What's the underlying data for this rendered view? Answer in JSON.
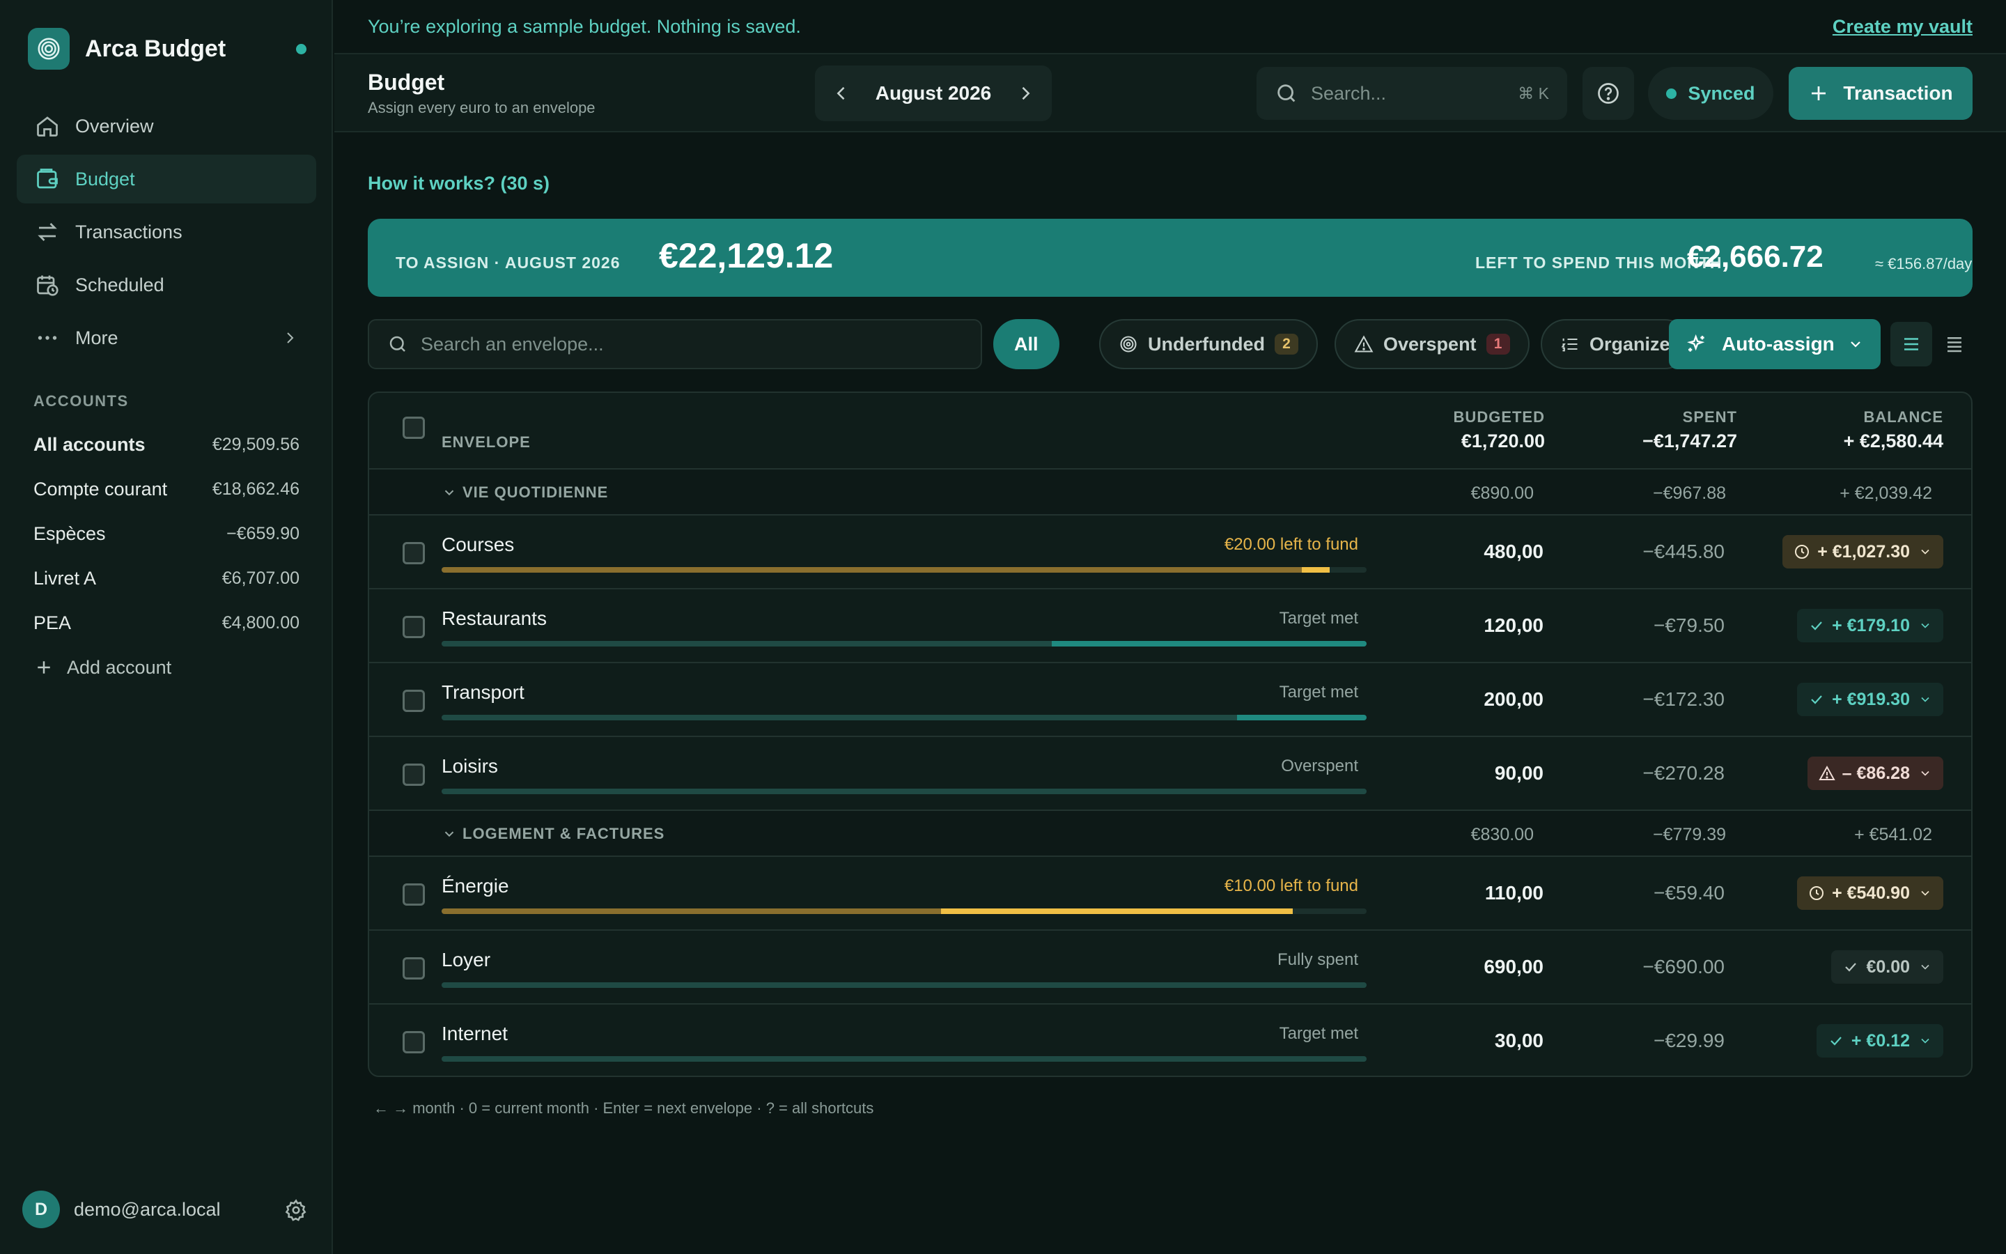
{
  "sidebar": {
    "brand": "Arca Budget",
    "nav": [
      {
        "label": "Overview",
        "icon": "home-icon"
      },
      {
        "label": "Budget",
        "icon": "wallet-icon"
      },
      {
        "label": "Transactions",
        "icon": "transfer-arrows-icon"
      },
      {
        "label": "Scheduled",
        "icon": "calendar-clock-icon"
      },
      {
        "label": "More",
        "icon": "more-dots-icon"
      }
    ],
    "accounts_heading": "ACCOUNTS",
    "accounts": [
      {
        "name": "All accounts",
        "amount": "€29,509.56"
      },
      {
        "name": "Compte courant",
        "amount": "€18,662.46"
      },
      {
        "name": "Espèces",
        "amount": "−€659.90"
      },
      {
        "name": "Livret A",
        "amount": "€6,707.00"
      },
      {
        "name": "PEA",
        "amount": "€4,800.00"
      }
    ],
    "add_account": "Add account",
    "user": {
      "initial": "D",
      "email": "demo@arca.local"
    }
  },
  "banner": {
    "message": "You’re exploring a sample budget. Nothing is saved.",
    "action": "Create my vault"
  },
  "header": {
    "title": "Budget",
    "subtitle": "Assign every euro to an envelope",
    "month": "August 2026",
    "search_placeholder": "Search...",
    "search_shortcut": "⌘ K",
    "sync_status": "Synced",
    "transaction_button": "Transaction"
  },
  "how_it_works": "How it works? (30 s)",
  "summary": {
    "to_assign_label": "TO ASSIGN · AUGUST 2026",
    "to_assign_value": "€22,129.12",
    "left_label": "LEFT TO SPEND THIS MONTH",
    "left_value": "€2,666.72",
    "per_day": "≈ €156.87/day"
  },
  "filters": {
    "search_placeholder": "Search an envelope...",
    "all": "All",
    "underfunded": "Underfunded",
    "underfunded_count": "2",
    "overspent": "Overspent",
    "overspent_count": "1",
    "organize": "Organize",
    "auto_assign": "Auto-assign"
  },
  "table": {
    "headers": {
      "envelope": "ENVELOPE",
      "budgeted": "BUDGETED",
      "budgeted_total": "€1,720.00",
      "spent": "SPENT",
      "spent_total": "−€1,747.27",
      "balance": "BALANCE",
      "balance_total": "+ €2,580.44"
    },
    "groups": [
      {
        "name": "VIE QUOTIDIENNE",
        "budgeted": "€890.00",
        "spent": "−€967.88",
        "balance": "+ €2,039.42",
        "rows": [
          {
            "name": "Courses",
            "status": "€20.00 left to fund",
            "budgeted": "480,00",
            "spent": "−€445.80",
            "balance": "+ €1,027.30",
            "balance_state": "underfunded",
            "progress_spent": 0.93,
            "progress_budget": 0.96
          },
          {
            "name": "Restaurants",
            "status": "Target met",
            "budgeted": "120,00",
            "spent": "−€79.50",
            "balance": "+ €179.10",
            "balance_state": "ok",
            "progress_spent": 0.66,
            "progress_budget": 1.0
          },
          {
            "name": "Transport",
            "status": "Target met",
            "budgeted": "200,00",
            "spent": "−€172.30",
            "balance": "+ €919.30",
            "balance_state": "ok",
            "progress_spent": 0.86,
            "progress_budget": 1.0
          },
          {
            "name": "Loisirs",
            "status": "Overspent",
            "budgeted": "90,00",
            "spent": "−€270.28",
            "balance": "– €86.28",
            "balance_state": "overspent",
            "progress_spent": 1.0,
            "progress_budget": 1.0
          }
        ]
      },
      {
        "name": "LOGEMENT & FACTURES",
        "budgeted": "€830.00",
        "spent": "−€779.39",
        "balance": "+ €541.02",
        "rows": [
          {
            "name": "Énergie",
            "status": "€10.00 left to fund",
            "budgeted": "110,00",
            "spent": "−€59.40",
            "balance": "+ €540.90",
            "balance_state": "underfunded",
            "progress_spent": 0.54,
            "progress_budget": 0.92
          },
          {
            "name": "Loyer",
            "status": "Fully spent",
            "budgeted": "690,00",
            "spent": "−€690.00",
            "balance": "€0.00",
            "balance_state": "zero",
            "progress_spent": 1.0,
            "progress_budget": 1.0
          },
          {
            "name": "Internet",
            "status": "Target met",
            "budgeted": "30,00",
            "spent": "−€29.99",
            "balance": "+ €0.12",
            "balance_state": "ok",
            "progress_spent": 1.0,
            "progress_budget": 1.0
          }
        ]
      }
    ]
  },
  "shortcuts_hint": "← → month · 0 = current month · Enter = next envelope · ? = all shortcuts",
  "colors": {
    "accent": "#1b7d74",
    "accent_text": "#5ed1c2",
    "warning": "#e7b54a",
    "background": "#0b1614"
  }
}
